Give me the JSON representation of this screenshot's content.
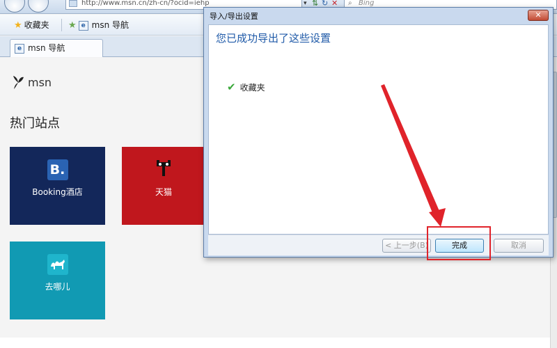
{
  "browser": {
    "address_url": "http://www.msn.cn/zh-cn/?ocid=iehp",
    "search_placeholder": "Bing",
    "favorites_label": "收藏夹",
    "fav_link_label": "msn 导航",
    "tab_label": "msn 导航"
  },
  "page": {
    "logo_text": "msn",
    "section_title": "热门站点",
    "tiles": [
      {
        "label": "Booking酒店",
        "icon": "booking-b-icon",
        "color": "#13275a",
        "glyph": "B."
      },
      {
        "label": "天猫",
        "icon": "tmall-cat-icon",
        "color": "#c0171d"
      },
      {
        "label": "去哪儿",
        "icon": "qunar-camel-icon",
        "color": "#119ab3"
      }
    ]
  },
  "dialog": {
    "title": "导入/导出设置",
    "close_glyph": "✕",
    "heading": "您已成功导出了这些设置",
    "result_item": "收藏夹",
    "prev_label": "< 上一步(B)",
    "done_label": "完成",
    "cancel_label": "取消"
  },
  "colors": {
    "annotation": "#e0232a",
    "heading_blue": "#1f5aa8"
  }
}
